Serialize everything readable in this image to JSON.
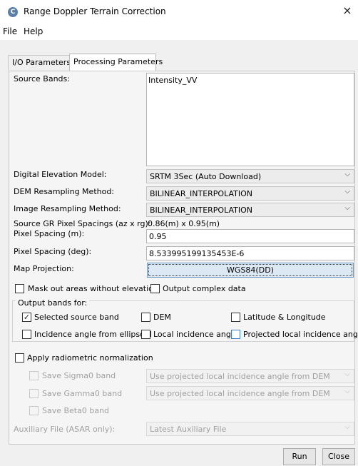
{
  "window": {
    "title": "Range Doppler Terrain Correction",
    "close_glyph": "×",
    "app_icon": "snap-app-icon"
  },
  "menu": {
    "file": "File",
    "help": "Help"
  },
  "tabs": {
    "io": "I/O Parameters",
    "processing": "Processing Parameters"
  },
  "source_bands": {
    "label": "Source Bands:",
    "value": "Intensity_VV"
  },
  "dem": {
    "label": "Digital Elevation Model:",
    "value": "SRTM 3Sec (Auto Download)"
  },
  "dem_resampling": {
    "label": "DEM Resampling Method:",
    "value": "BILINEAR_INTERPOLATION"
  },
  "image_resampling": {
    "label": "Image Resampling Method:",
    "value": "BILINEAR_INTERPOLATION"
  },
  "gr_spacing": {
    "label": "Source GR Pixel Spacings (az x rg):",
    "value": "0.86(m) x 0.95(m)"
  },
  "pixel_spacing_m": {
    "label": "Pixel Spacing (m):",
    "value": "0.95"
  },
  "pixel_spacing_deg": {
    "label": "Pixel Spacing (deg):",
    "value": "8.533995199135453E-6"
  },
  "map_projection": {
    "label": "Map Projection:",
    "value": "WGS84(DD)"
  },
  "mask_out": {
    "label": "Mask out areas without elevation",
    "checked": false
  },
  "output_complex": {
    "label": "Output complex data",
    "checked": false
  },
  "output_bands": {
    "title": "Output bands for:",
    "selected_source": {
      "label": "Selected source band",
      "checked": true,
      "glyph": "✓"
    },
    "dem": {
      "label": "DEM",
      "checked": false
    },
    "lat_long": {
      "label": "Latitude & Longitude",
      "checked": false
    },
    "incidence_ellipsoid": {
      "label": "Incidence angle from ellipsoid",
      "checked": false
    },
    "local_incidence": {
      "label": "Local incidence angle",
      "checked": false
    },
    "projected_local_incidence": {
      "label": "Projected local incidence angle",
      "checked": false
    }
  },
  "radiometric": {
    "label": "Apply radiometric normalization",
    "checked": false
  },
  "save_sigma0": {
    "label": "Save Sigma0 band",
    "combo": "Use projected local incidence angle from DEM"
  },
  "save_gamma0": {
    "label": "Save Gamma0 band",
    "combo": "Use projected local incidence angle from DEM"
  },
  "save_beta0": {
    "label": "Save Beta0 band"
  },
  "aux_file": {
    "label": "Auxiliary File (ASAR only):",
    "value": "Latest Auxiliary File"
  },
  "buttons": {
    "run": "Run",
    "close": "Close"
  },
  "icons": {
    "dropdown": "⌵"
  }
}
